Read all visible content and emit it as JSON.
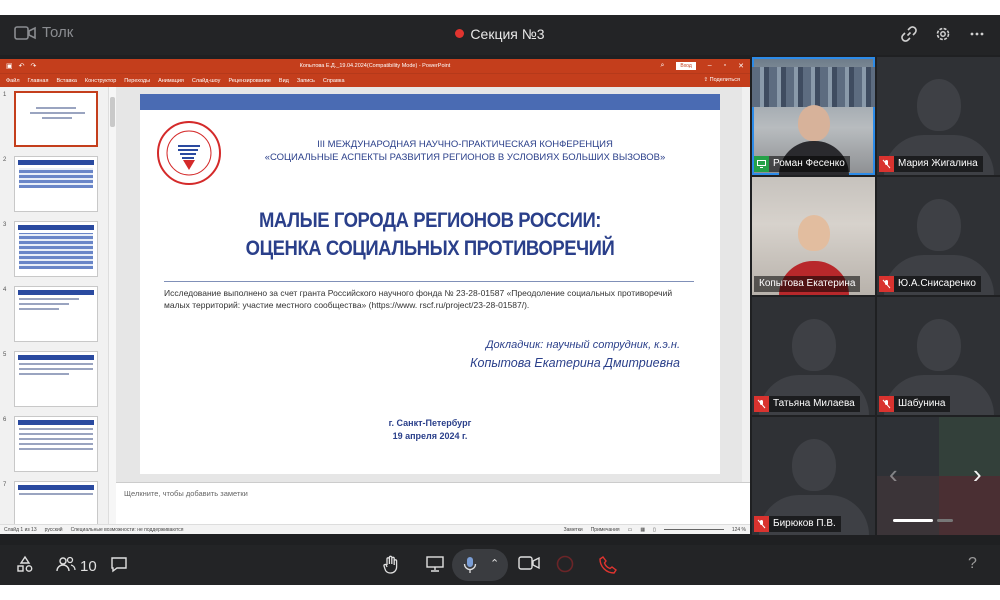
{
  "app": {
    "brand": "Толк",
    "section": "Секция №3",
    "accent": "#2c8be8",
    "record_color": "#e0342f"
  },
  "top_icons": [
    "link-icon",
    "gear-icon",
    "more-icon"
  ],
  "ppt": {
    "filename": "Копытова Е.Д._19.04.2024(Compatibility Mode) - PowerPoint",
    "login": "Вход",
    "menu": [
      "Файл",
      "Главная",
      "Вставка",
      "Конструктор",
      "Переходы",
      "Анимация",
      "Слайд-шоу",
      "Рецензирование",
      "Вид",
      "Запись",
      "Справка"
    ],
    "share": "Поделиться",
    "thumb_numbers": [
      "1",
      "2",
      "3",
      "4",
      "5",
      "6",
      "7"
    ],
    "notes_placeholder": "Щелкните, чтобы добавить заметки",
    "status_left": [
      "Слайд 1 из 13",
      "русский",
      "Специальные возможности: не поддерживаются"
    ],
    "status_right": [
      "Заметки",
      "Примечания",
      "124 %"
    ],
    "accent": "#c43e1c"
  },
  "slide": {
    "logo_text": "ВолНЦ РАН",
    "conf_line1": "III МЕЖДУНАРОДНАЯ НАУЧНО-ПРАКТИЧЕСКАЯ КОНФЕРЕНЦИЯ",
    "conf_line2": "«СОЦИАЛЬНЫЕ АСПЕКТЫ РАЗВИТИЯ РЕГИОНОВ В УСЛОВИЯХ БОЛЬШИХ ВЫЗОВОВ»",
    "title_line1": "МАЛЫЕ ГОРОДА РЕГИОНОВ РОССИИ:",
    "title_line2": "ОЦЕНКА СОЦИАЛЬНЫХ ПРОТИВОРЕЧИЙ",
    "research": "Исследование выполнено за счет гранта Российского научного фонда № 23-28-01587 «Преодоление социальных противоречий малых территорий: участие местного сообщества» (https://www. rscf.ru/project/23-28-01587/).",
    "speaker_role": "Докладчик: научный сотрудник, к.э.н.",
    "speaker_name": "Копытова Екатерина Дмитриевна",
    "city": "г. Санкт-Петербург",
    "date": "19 апреля 2024 г."
  },
  "participants": [
    {
      "name": "Роман Фесенко",
      "mic": "on",
      "video": true
    },
    {
      "name": "Мария Жигалина",
      "mic": "muted",
      "video": false
    },
    {
      "name": "Копытова Екатерина",
      "mic": "none",
      "video": true
    },
    {
      "name": "Ю.А.Снисаренко",
      "mic": "muted",
      "video": false
    },
    {
      "name": "Татьяна Милаева",
      "mic": "muted",
      "video": false
    },
    {
      "name": "Шабунина",
      "mic": "muted",
      "video": false
    },
    {
      "name": "Бирюков П.В.",
      "mic": "muted",
      "video": false
    }
  ],
  "bottom": {
    "participants_count": "10",
    "help": "?"
  }
}
